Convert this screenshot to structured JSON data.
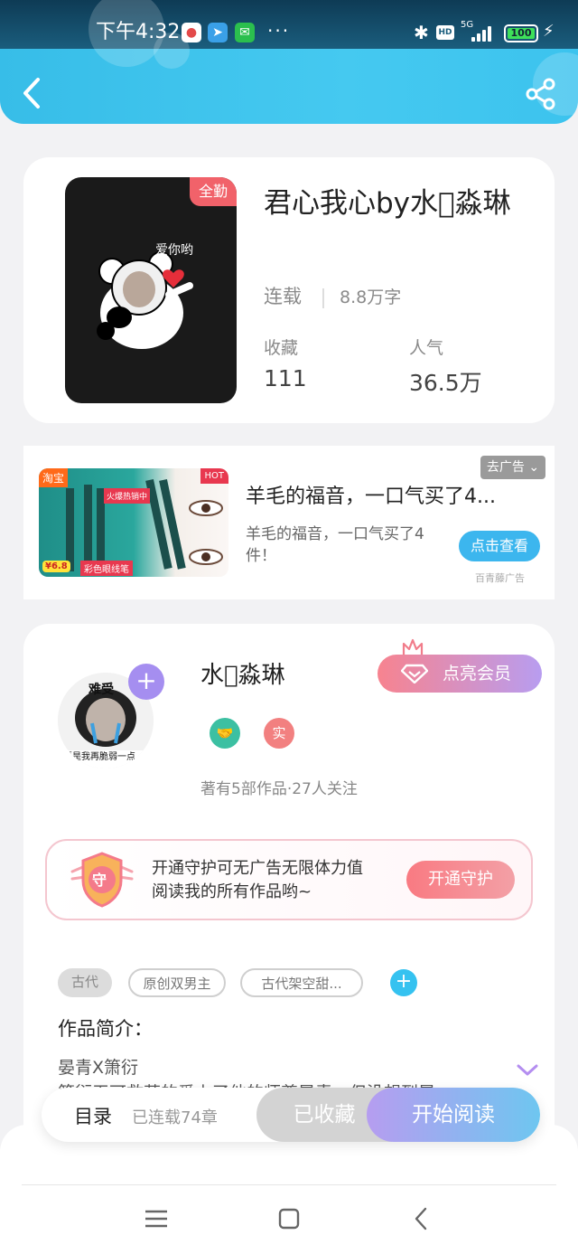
{
  "status_bar": {
    "time": "下午4:32",
    "network": "5G",
    "battery": "100"
  },
  "header": {
    "back_icon": "chevron-left-icon",
    "share_icon": "share-icon"
  },
  "book": {
    "cover_badge": "全勤",
    "cover_text": "爱你哟",
    "title": "君心我心by水𣲖淼琳",
    "status": "连载",
    "word_count": "8.8万字",
    "stats": [
      {
        "label": "收藏",
        "value": "111"
      },
      {
        "label": "人气",
        "value": "36.5万"
      }
    ]
  },
  "ad": {
    "close_label": "去广告",
    "title": "羊毛的福音，一口气买了4...",
    "description": "羊毛的福音，一口气买了4件！",
    "button_label": "点击查看",
    "source": "百青藤广告",
    "image_tag_left": "淘宝",
    "image_tag_hot": "HOT",
    "image_banner": "火爆热销中",
    "image_price": "¥6.8",
    "image_caption": "彩色眼线笔"
  },
  "author": {
    "name": "水𣲖淼琳",
    "avatar_caption": "难受",
    "avatar_bottom": "要是我再脆弱一点",
    "vip_label": "点亮会员",
    "badge_real": "实",
    "works_info": "著有5部作品·27人关注",
    "guard_text_line1": "开通守护可无广告无限体力值",
    "guard_text_line2": "阅读我的所有作品哟~",
    "guard_button": "开通守护",
    "guard_icon_text": "守",
    "tags": [
      "古代",
      "原创双男主",
      "古代架空甜..."
    ],
    "intro_heading": "作品简介：",
    "intro_line1": "晏青X箫衍",
    "intro_line2": "箫衍无可救药的爱上了他的师尊晏青，但没想到晏"
  },
  "action_bar": {
    "toc_label": "目录",
    "toc_count": "已连载74章",
    "collected_label": "已收藏",
    "read_label": "开始阅读"
  },
  "colors": {
    "header_blue": "#3cc3ee",
    "accent_pink": "#f1626a",
    "accent_purple": "#a58ef0"
  }
}
